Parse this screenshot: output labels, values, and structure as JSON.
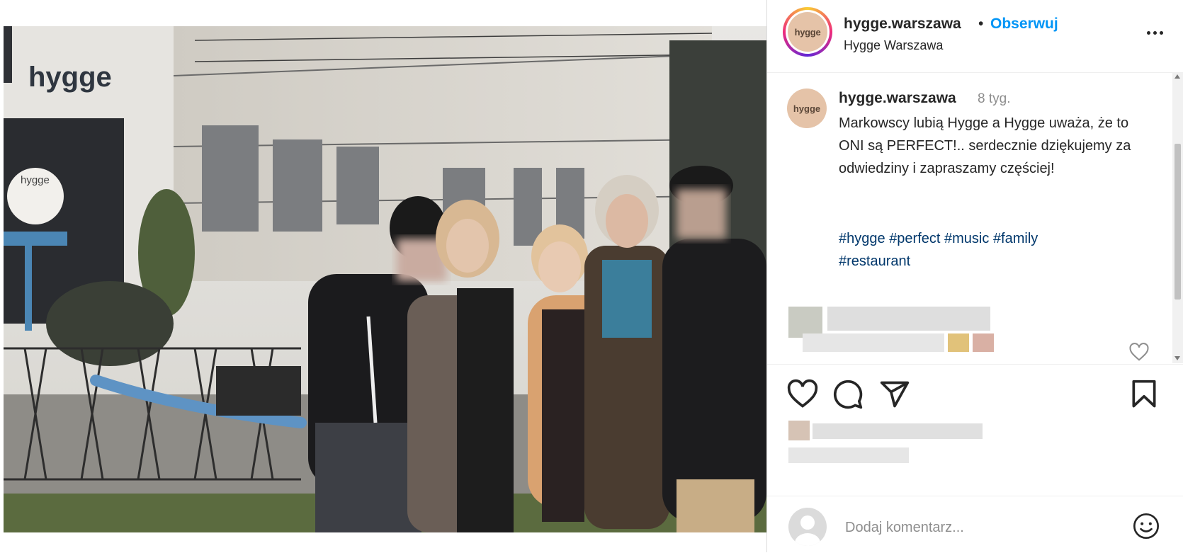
{
  "post": {
    "photo_alt": "",
    "storefront_sign": "hygge",
    "round_sign": "hygge"
  },
  "header": {
    "username": "hygge.warszawa",
    "separator": "•",
    "follow_label": "Obserwuj",
    "location": "Hygge Warszawa",
    "avatar_text": "hygge"
  },
  "caption": {
    "username": "hygge.warszawa",
    "time_ago": "8 tyg.",
    "text": "Markowscy lubią Hygge a Hygge uważa, że to ONI są PERFECT!.. serdecznie dziękujemy za odwiedziny i zapraszamy częściej!",
    "hashtags": [
      "#hygge",
      "#perfect",
      "#music",
      "#family",
      "#restaurant"
    ],
    "avatar_text": "hygge"
  },
  "actions": {
    "like_icon": "heart-icon",
    "comment_icon": "comment-icon",
    "share_icon": "share-icon",
    "save_icon": "bookmark-icon"
  },
  "comment_box": {
    "placeholder": "Dodaj komentarz...",
    "emoji_icon": "emoji-icon"
  },
  "colors": {
    "accent": "#0095f6",
    "hashtag": "#00376b",
    "muted": "#8e8e8e",
    "text": "#262626"
  }
}
